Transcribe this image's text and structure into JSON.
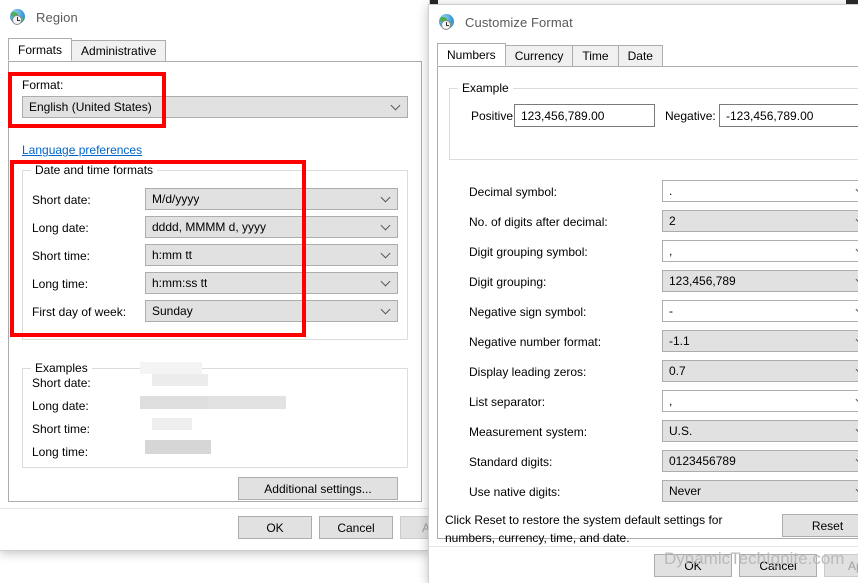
{
  "region_window": {
    "title": "Region",
    "icon": "region-globe-clock-icon",
    "tabs": [
      {
        "label": "Formats",
        "active": true
      },
      {
        "label": "Administrative",
        "active": false
      }
    ],
    "format_label": "Format:",
    "format_value": "English (United States)",
    "language_preferences_link": "Language preferences",
    "date_time_group_title": "Date and time formats",
    "date_time_rows": [
      {
        "label": "Short date:",
        "value": "M/d/yyyy"
      },
      {
        "label": "Long date:",
        "value": "dddd, MMMM d, yyyy"
      },
      {
        "label": "Short time:",
        "value": "h:mm tt"
      },
      {
        "label": "Long time:",
        "value": "h:mm:ss tt"
      },
      {
        "label": "First day of week:",
        "value": "Sunday"
      }
    ],
    "examples_group_title": "Examples",
    "example_rows": [
      {
        "label": "Short date:",
        "value": ""
      },
      {
        "label": "Long date:",
        "value": ""
      },
      {
        "label": "Short time:",
        "value": ""
      },
      {
        "label": "Long time:",
        "value": ""
      }
    ],
    "additional_settings_button": "Additional settings...",
    "buttons": [
      {
        "label": "OK",
        "enabled": true
      },
      {
        "label": "Cancel",
        "enabled": true
      },
      {
        "label": "Apply",
        "enabled": false
      }
    ]
  },
  "customize_window": {
    "title": "Customize Format",
    "icon": "customize-globe-clock-icon",
    "tabs": [
      {
        "label": "Numbers",
        "active": true
      },
      {
        "label": "Currency",
        "active": false
      },
      {
        "label": "Time",
        "active": false
      },
      {
        "label": "Date",
        "active": false
      }
    ],
    "example_group_title": "Example",
    "example_positive_label": "Positive:",
    "example_positive_value": "123,456,789.00",
    "example_negative_label": "Negative:",
    "example_negative_value": "-123,456,789.00",
    "settings": [
      {
        "label": "Decimal symbol:",
        "value": ".",
        "editable": true
      },
      {
        "label": "No. of digits after decimal:",
        "value": "2",
        "editable": false
      },
      {
        "label": "Digit grouping symbol:",
        "value": ",",
        "editable": true
      },
      {
        "label": "Digit grouping:",
        "value": "123,456,789",
        "editable": false
      },
      {
        "label": "Negative sign symbol:",
        "value": "-",
        "editable": true
      },
      {
        "label": "Negative number format:",
        "value": "-1.1",
        "editable": false
      },
      {
        "label": "Display leading zeros:",
        "value": "0.7",
        "editable": false
      },
      {
        "label": "List separator:",
        "value": ",",
        "editable": true
      },
      {
        "label": "Measurement system:",
        "value": "U.S.",
        "editable": false
      },
      {
        "label": "Standard digits:",
        "value": "0123456789",
        "editable": false
      },
      {
        "label": "Use native digits:",
        "value": "Never",
        "editable": false
      }
    ],
    "reset_hint_line1": "Click Reset to restore the system default settings for",
    "reset_hint_line2": "numbers, currency, time, and date.",
    "reset_button": "Reset",
    "buttons": [
      {
        "label": "OK",
        "enabled": true
      },
      {
        "label": "Cancel",
        "enabled": true
      },
      {
        "label": "Apply",
        "enabled": false
      }
    ]
  },
  "annotations": {
    "highlight_color": "#ff0000",
    "boxes": [
      {
        "name": "format-section-highlight"
      },
      {
        "name": "date-time-formats-highlight"
      }
    ]
  },
  "watermark": {
    "text": "DynamicTechIgnite.com"
  }
}
